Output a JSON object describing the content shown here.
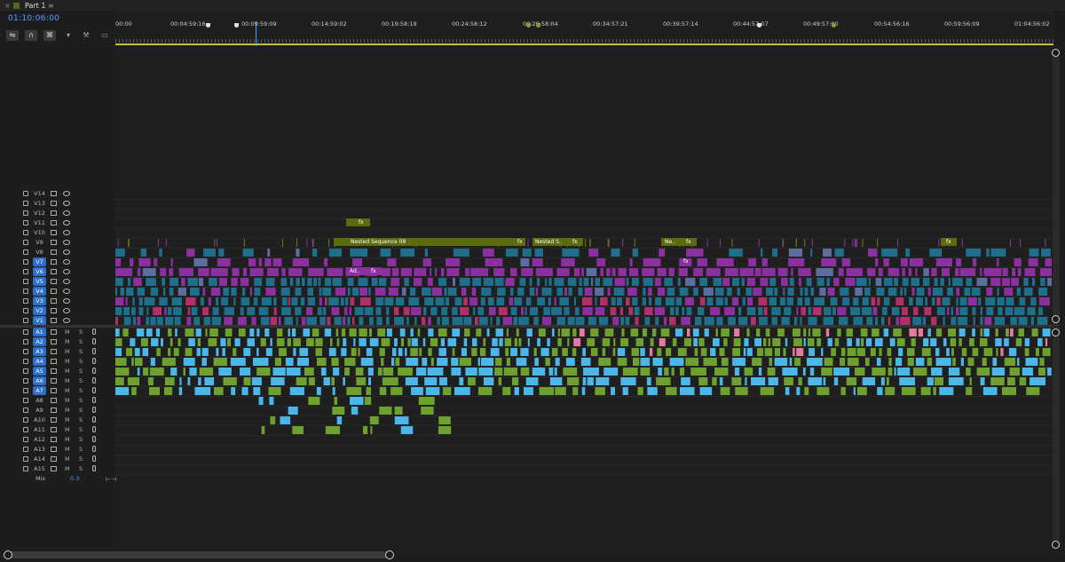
{
  "tab": {
    "title": "Part 1"
  },
  "timecode": "01:10:06:00",
  "ruler_labels": [
    "00:00",
    "00:04:59:16",
    "00:09:59:09",
    "00:14:59:02",
    "00:19:58:19",
    "00:24:58:12",
    "00:29:58:04",
    "00:34:57:21",
    "00:39:57:14",
    "00:44:57:07",
    "00:49:57:00",
    "00:54:56:16",
    "00:59:56:09",
    "01:04:56:02"
  ],
  "video_tracks": [
    {
      "label": "V14",
      "on": false
    },
    {
      "label": "V13",
      "on": false
    },
    {
      "label": "V12",
      "on": false
    },
    {
      "label": "V11",
      "on": false
    },
    {
      "label": "V10",
      "on": false
    },
    {
      "label": "V9",
      "on": false
    },
    {
      "label": "V8",
      "on": false
    },
    {
      "label": "V7",
      "on": true
    },
    {
      "label": "V6",
      "on": true
    },
    {
      "label": "V5",
      "on": true
    },
    {
      "label": "V4",
      "on": true
    },
    {
      "label": "V3",
      "on": true
    },
    {
      "label": "V2",
      "on": true
    },
    {
      "label": "V1",
      "on": true
    }
  ],
  "audio_tracks": [
    {
      "label": "A1",
      "on": true
    },
    {
      "label": "A2",
      "on": true
    },
    {
      "label": "A3",
      "on": true
    },
    {
      "label": "A4",
      "on": true
    },
    {
      "label": "A5",
      "on": true
    },
    {
      "label": "A6",
      "on": true
    },
    {
      "label": "A7",
      "on": true
    },
    {
      "label": "A8",
      "on": false
    },
    {
      "label": "A9",
      "on": false
    },
    {
      "label": "A10",
      "on": false
    },
    {
      "label": "A11",
      "on": false
    },
    {
      "label": "A12",
      "on": false
    },
    {
      "label": "A13",
      "on": false
    },
    {
      "label": "A14",
      "on": false
    },
    {
      "label": "A15",
      "on": false
    }
  ],
  "audio_buttons": {
    "mute": "M",
    "solo": "S"
  },
  "mix": {
    "label": "Mix",
    "value": "0.3"
  },
  "clip_labels": {
    "nested_main": "Nested Sequence 08",
    "nested_short": "Nested S..",
    "ne": "Ne..",
    "ad": "Ad..",
    "fx": "fx"
  },
  "colors": {
    "accent": "#4aa0ff",
    "olive": "#6e7d12",
    "magenta": "#8c2fa0",
    "teal": "#1d6f8c",
    "green_audio": "#6ea030",
    "blue_audio": "#4bb6e8",
    "pink_audio": "#e37aa0"
  }
}
